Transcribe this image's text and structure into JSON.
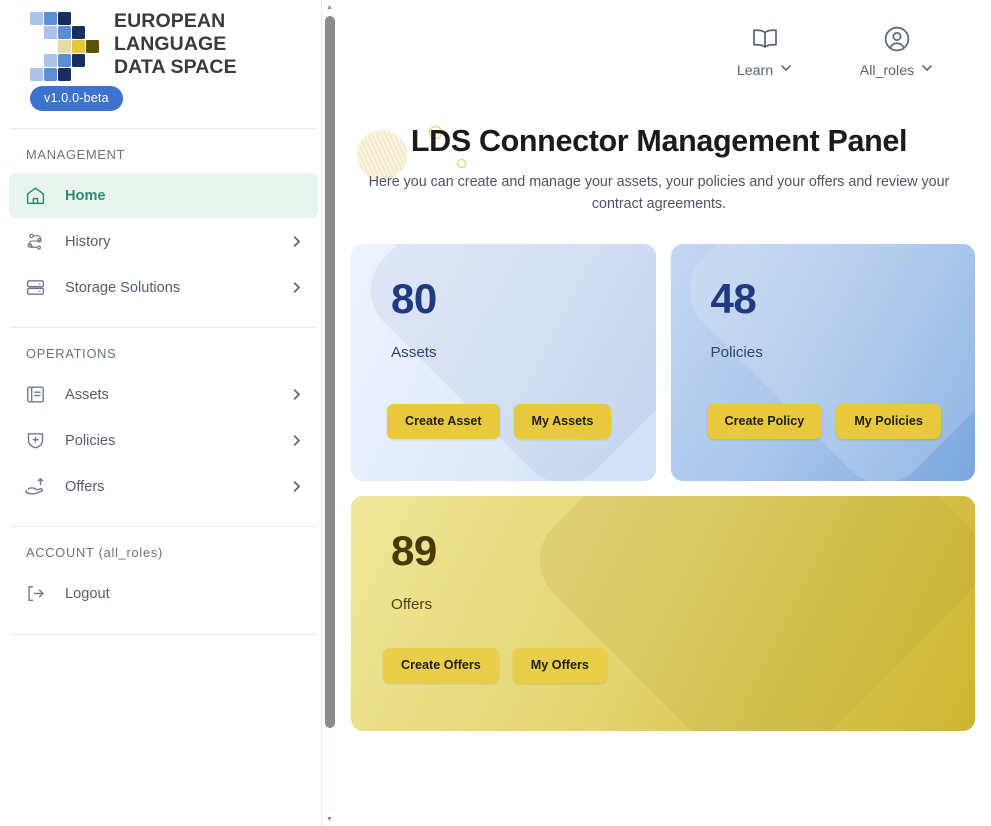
{
  "brand": {
    "name_lines": [
      "EUROPEAN",
      "LANGUAGE",
      "DATA SPACE"
    ],
    "version": "v1.0.0-beta",
    "logo_colors": {
      "light_blue": "#aac4e8",
      "mid_blue": "#5c8ed6",
      "dark_navy": "#17305e",
      "cream": "#e5d9a4",
      "gold": "#e8c53a",
      "olive": "#5d5209"
    }
  },
  "sidebar": {
    "sections": [
      {
        "label": "MANAGEMENT",
        "items": [
          {
            "label": "Home",
            "icon": "home-icon",
            "active": true,
            "chevron": false
          },
          {
            "label": "History",
            "icon": "history-icon",
            "active": false,
            "chevron": true
          },
          {
            "label": "Storage Solutions",
            "icon": "storage-icon",
            "active": false,
            "chevron": true
          }
        ]
      },
      {
        "label": "OPERATIONS",
        "items": [
          {
            "label": "Assets",
            "icon": "assets-icon",
            "active": false,
            "chevron": true
          },
          {
            "label": "Policies",
            "icon": "policies-shield-icon",
            "active": false,
            "chevron": true
          },
          {
            "label": "Offers",
            "icon": "offers-hand-icon",
            "active": false,
            "chevron": true
          }
        ]
      },
      {
        "label": "ACCOUNT (all_roles)",
        "items": [
          {
            "label": "Logout",
            "icon": "logout-icon",
            "active": false,
            "chevron": false
          }
        ]
      }
    ],
    "active_color": "#2f8a72",
    "active_background": "#e8f5ef"
  },
  "topbar": {
    "actions": [
      {
        "label": "Learn",
        "icon": "book-icon"
      },
      {
        "label": "All_roles",
        "icon": "user-circle-icon"
      }
    ]
  },
  "hero": {
    "title": "LDS Connector Management Panel",
    "subtitle": "Here you can create and manage your assets, your policies and your offers and review your contract agreements."
  },
  "cards": [
    {
      "count": "80",
      "label": "Assets",
      "buttons": [
        "Create Asset",
        "My Assets"
      ],
      "theme": "light-blue"
    },
    {
      "count": "48",
      "label": "Policies",
      "buttons": [
        "Create Policy",
        "My Policies"
      ],
      "theme": "blue"
    },
    {
      "count": "89",
      "label": "Offers",
      "buttons": [
        "Create Offers",
        "My Offers"
      ],
      "theme": "gold"
    }
  ],
  "scrollbar": {
    "up_arrow": "▲",
    "down_arrow": "▼"
  }
}
